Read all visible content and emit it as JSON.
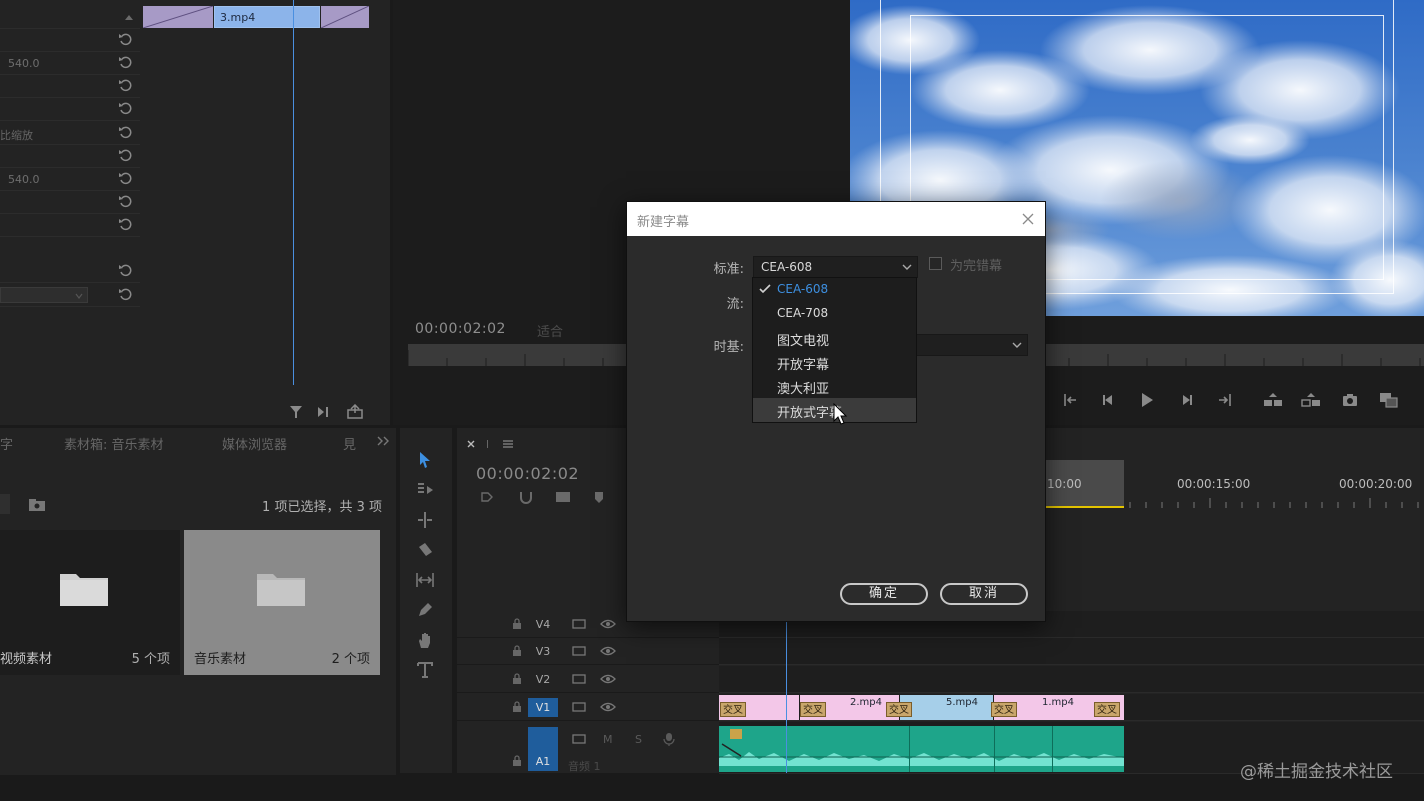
{
  "effect_controls": {
    "values": [
      "540.0",
      "比缩放",
      "540.0"
    ],
    "clip_name": "3.mp4"
  },
  "program_monitor": {
    "timecode": "00:00:02:02",
    "fit": "适合"
  },
  "project": {
    "tabs": [
      "字",
      "素材箱: 音乐素材",
      "媒体浏览器",
      "見"
    ],
    "selection_info": "1 项已选择，共 3 项",
    "bins": [
      {
        "name": "视频素材",
        "count": "5 个项"
      },
      {
        "name": "音乐素材",
        "count": "2 个项"
      }
    ]
  },
  "timeline": {
    "timecode": "00:00:02:02",
    "ruler": [
      "10:00",
      "00:00:15:00",
      "00:00:20:00"
    ],
    "tracks": [
      "V4",
      "V3",
      "V2",
      "V1",
      "A1"
    ],
    "audio_track_label": "音频 1",
    "audio_buttons": [
      "M",
      "S"
    ],
    "clips": [
      "2.mp4",
      "5.mp4",
      "1.mp4"
    ],
    "transition_label": "交叉"
  },
  "dialog": {
    "title": "新建字幕",
    "standard_label": "标准:",
    "standard_value": "CEA-608",
    "stream_label": "流:",
    "timebase_label": "时基:",
    "checkbox_label": "为完错幕",
    "ok": "确定",
    "cancel": "取消"
  },
  "dropdown": {
    "items": [
      "CEA-608",
      "CEA-708",
      "图文电视",
      "开放字幕",
      "澳大利亚",
      "开放式字幕"
    ]
  },
  "watermark": "@稀土掘金技术社区",
  "colors": {
    "accent_blue": "#3d8fe0",
    "track_active": "#1f5d9c",
    "video_clip": "#a6cfe9",
    "audio_clip": "#1ea58a",
    "playhead": "#4a8fe0"
  }
}
